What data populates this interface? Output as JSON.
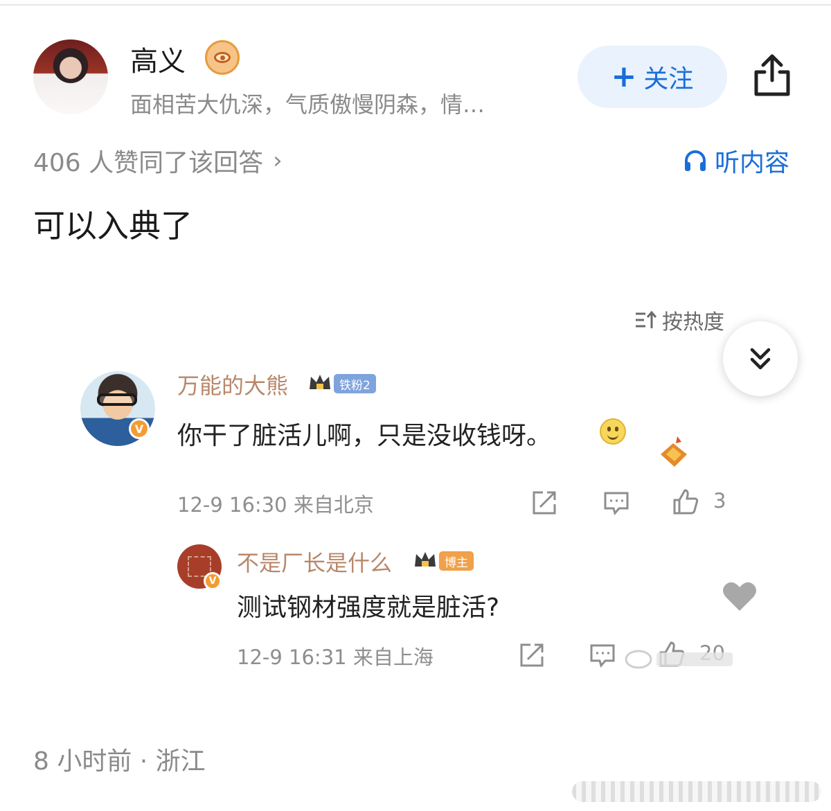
{
  "author": {
    "name": "高义",
    "description": "面相苦大仇深，气质傲慢阴森，情…",
    "follow_label": "关注",
    "follow_plus": "+",
    "badge_icon": "eye-badge-icon"
  },
  "answer": {
    "likes_text": "406 人赞同了该回答",
    "listen_label": "听内容",
    "text": "可以入典了",
    "footer": "8 小时前 · 浙江"
  },
  "screenshot": {
    "sort_label": "按热度",
    "comments": [
      {
        "name": "万能的大熊",
        "fan_tag": "铁粉2",
        "text": "你干了脏活儿啊，只是没收钱呀。",
        "meta": "12-9 16:30  来自北京",
        "likes": "3"
      },
      {
        "name": "不是厂长是什么",
        "fan_tag": "博主",
        "text": "测试钢材强度就是脏活?",
        "meta": "12-9 16:31  来自上海",
        "likes": "20"
      }
    ]
  },
  "colors": {
    "accent_blue": "#1a6ed8",
    "follow_bg": "#eaf2fd",
    "gray_text": "#8a8a8a",
    "name_brown": "#b8876a"
  }
}
